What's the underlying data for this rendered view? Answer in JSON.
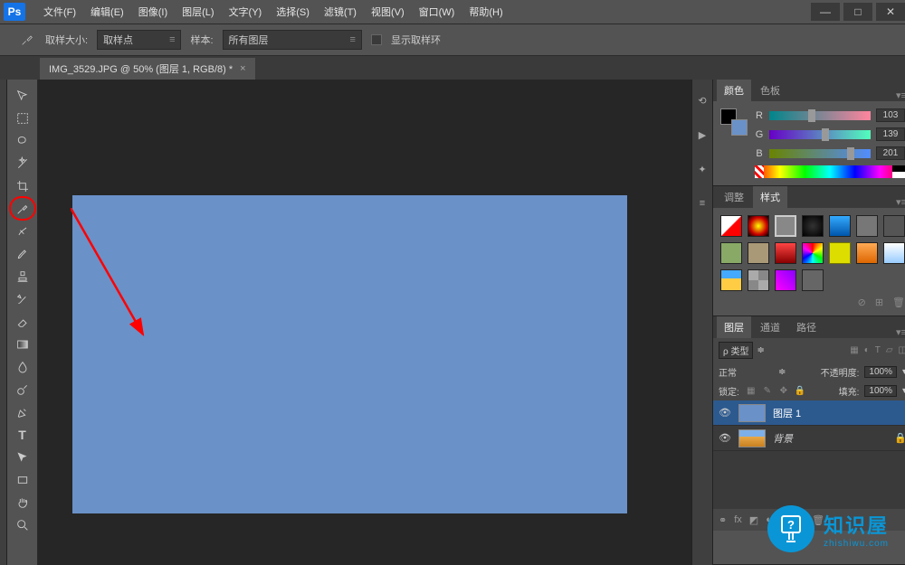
{
  "app": {
    "logo": "Ps"
  },
  "menu": [
    "文件(F)",
    "编辑(E)",
    "图像(I)",
    "图层(L)",
    "文字(Y)",
    "选择(S)",
    "滤镜(T)",
    "视图(V)",
    "窗口(W)",
    "帮助(H)"
  ],
  "win": {
    "min": "—",
    "max": "□",
    "close": "✕"
  },
  "options": {
    "sample_size_label": "取样大小:",
    "sample_size_value": "取样点",
    "sample_label": "样本:",
    "sample_value": "所有图层",
    "show_ring": "显示取样环"
  },
  "tab": {
    "title": "IMG_3529.JPG @ 50% (图层 1, RGB/8) *",
    "close": "×"
  },
  "tools": [
    {
      "name": "move-tool"
    },
    {
      "name": "marquee-tool"
    },
    {
      "name": "lasso-tool"
    },
    {
      "name": "wand-tool"
    },
    {
      "name": "crop-tool"
    },
    {
      "name": "eyedropper-tool",
      "hl": true
    },
    {
      "name": "healing-brush-tool"
    },
    {
      "name": "brush-tool"
    },
    {
      "name": "stamp-tool"
    },
    {
      "name": "history-brush-tool"
    },
    {
      "name": "eraser-tool"
    },
    {
      "name": "gradient-tool"
    },
    {
      "name": "blur-tool"
    },
    {
      "name": "dodge-tool"
    },
    {
      "name": "pen-tool"
    },
    {
      "name": "type-tool"
    },
    {
      "name": "path-select-tool"
    },
    {
      "name": "rect-tool"
    },
    {
      "name": "hand-tool"
    },
    {
      "name": "zoom-tool"
    }
  ],
  "color": {
    "tabs": [
      "颜色",
      "色板"
    ],
    "r_label": "R",
    "r_val": "103",
    "g_label": "G",
    "g_val": "139",
    "b_label": "B",
    "b_val": "201",
    "fg": "#000000",
    "bg": "#6a91c8"
  },
  "adjust": {
    "tabs": [
      "调整",
      "样式"
    ]
  },
  "layers": {
    "tabs": [
      "图层",
      "通道",
      "路径"
    ],
    "filter_label": "ρ 类型",
    "blend": "正常",
    "opacity_label": "不透明度:",
    "opacity_val": "100%",
    "lock_label": "锁定:",
    "fill_label": "填充:",
    "fill_val": "100%",
    "items": [
      {
        "name": "图层 1",
        "thumb": "blue",
        "active": true,
        "locked": false
      },
      {
        "name": "背景",
        "thumb": "img",
        "active": false,
        "locked": true,
        "italic": true
      }
    ]
  },
  "watermark": {
    "cn": "知识屋",
    "en": "zhishiwu.com"
  }
}
